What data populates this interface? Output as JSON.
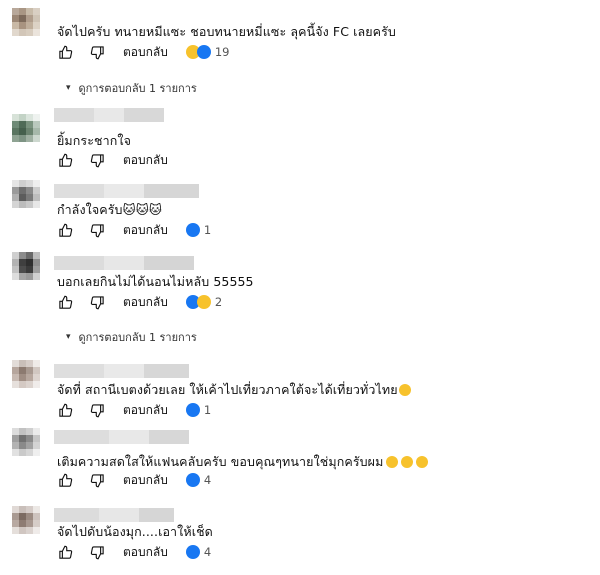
{
  "comments": [
    {
      "text": "จัดไปครับ ทนายหมีแซะ ชอบทนายหมี่แซะ ลุคนี้จัง FC เลยครับ",
      "reply_label": "ตอบกลับ",
      "reaction_count": "19",
      "replies_label": "ดูการตอบกลับ 1 รายการ"
    },
    {
      "text": "ยิ้มกระชากใจ",
      "reply_label": "ตอบกลับ",
      "reaction_count": ""
    },
    {
      "text": "กำลังใจครับ🐱🐱🐱",
      "reply_label": "ตอบกลับ",
      "reaction_count": "1"
    },
    {
      "text": "บอกเลยกินไม่ได้นอนไม่หลับ 55555",
      "reply_label": "ตอบกลับ",
      "reaction_count": "2",
      "replies_label": "ดูการตอบกลับ 1 รายการ"
    },
    {
      "text": "จัดที่ สถานีเบตงด้วยเลย ให้เค้าไปเที่ยวภาคใต้จะได้เที่ยวทั่วไทย",
      "reply_label": "ตอบกลับ",
      "reaction_count": "1"
    },
    {
      "text": "เติมความสดใสให้แฟนคลับครับ ขอบคุณๆทนายใช่มุกครับผม",
      "reply_label": "ตอบกลับ",
      "reaction_count": "4"
    },
    {
      "text": "จัดไปดับน้องมุก....เอาให้เช็ด",
      "reply_label": "ตอบกลับ",
      "reaction_count": "4"
    }
  ],
  "colors": {
    "like_badge": "#1877f2",
    "haha_badge": "#f7c22c",
    "text": "#0f0f0f"
  }
}
